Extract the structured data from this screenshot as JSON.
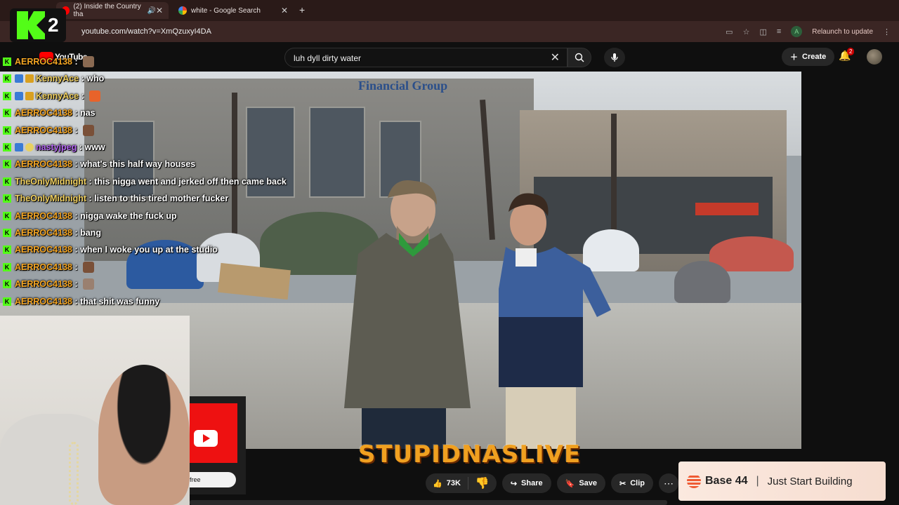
{
  "browser": {
    "tabs": [
      {
        "label": "(2) Inside the Country tha",
        "active": true
      },
      {
        "label": "white - Google Search",
        "active": false
      }
    ],
    "url": "youtube.com/watch?v=XmQzuxyI4DA",
    "relaunch_label": "Relaunch to update",
    "profile_initial": "A"
  },
  "youtube": {
    "logo_text": "YouTube",
    "search_query": "luh dyll dirty water",
    "create_label": "Create",
    "notification_count": "2"
  },
  "video_scene": {
    "building_sign": "Financial Group"
  },
  "overlay": {
    "kick_number": "2",
    "watermark": "STUPIDNASLIVE"
  },
  "chat": [
    {
      "user": "AERROC4138",
      "color": "#f5a623",
      "text": "",
      "emote": "#8a6a52"
    },
    {
      "user": "KennyAce",
      "color": "#f0d060",
      "text": "who",
      "emote": ""
    },
    {
      "user": "KennyAce",
      "color": "#f0d060",
      "text": "",
      "emote": "#e8632a"
    },
    {
      "user": "AERROC4138",
      "color": "#f5a623",
      "text": "nas",
      "emote": ""
    },
    {
      "user": "AERROC4138",
      "color": "#f5a623",
      "text": "",
      "emote": "#7a5038"
    },
    {
      "user": "nastyjpeg",
      "color": "#b264f0",
      "text": "www",
      "emote": ""
    },
    {
      "user": "AERROC4138",
      "color": "#f5a623",
      "text": "what's this half way houses",
      "emote": ""
    },
    {
      "user": "TheOnlyMidnight",
      "color": "#f0d060",
      "text": "this nigga went and jerked off then came back",
      "emote": ""
    },
    {
      "user": "TheOnlyMidnight",
      "color": "#f0d060",
      "text": "listen to this tired mother fucker",
      "emote": ""
    },
    {
      "user": "AERROC4138",
      "color": "#f5a623",
      "text": "nigga wake the fuck up",
      "emote": ""
    },
    {
      "user": "AERROC4138",
      "color": "#f5a623",
      "text": "bang",
      "emote": ""
    },
    {
      "user": "AERROC4138",
      "color": "#f5a623",
      "text": "when I woke you up at the studio",
      "emote": ""
    },
    {
      "user": "AERROC4138",
      "color": "#f5a623",
      "text": "",
      "emote": "#7a5038"
    },
    {
      "user": "AERROC4138",
      "color": "#f5a623",
      "text": "",
      "emote": "#9a8070"
    },
    {
      "user": "AERROC4138",
      "color": "#f5a623",
      "text": "that shit was funny",
      "emote": ""
    }
  ],
  "promo": {
    "button_label": "free"
  },
  "actions": {
    "like_count": "73K",
    "share_label": "Share",
    "save_label": "Save",
    "clip_label": "Clip"
  },
  "ad": {
    "brand": "Base 44",
    "separator": "|",
    "tagline": "Just Start Building"
  }
}
